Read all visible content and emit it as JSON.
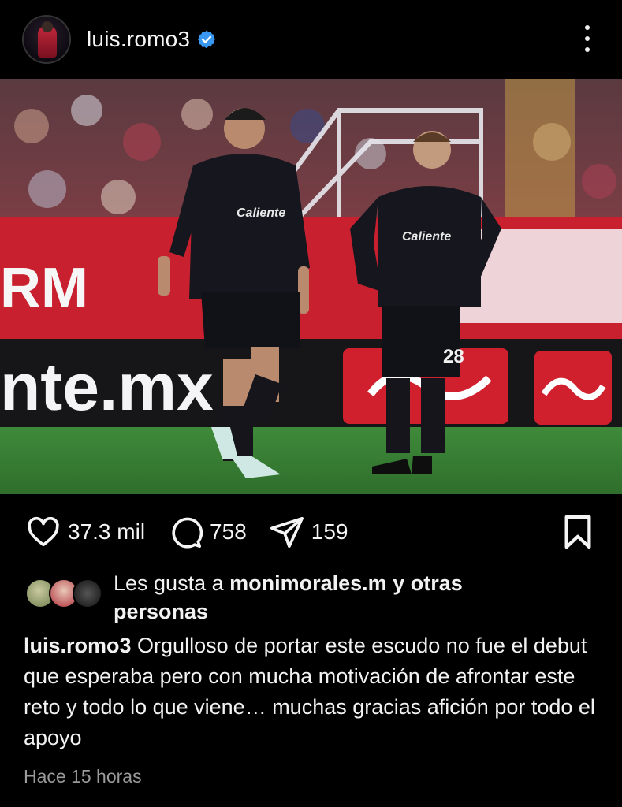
{
  "post": {
    "username": "luis.romo3",
    "verified": true,
    "icons": {
      "avatar": "profile-avatar",
      "verified": "verified-badge-icon",
      "more": "more-vertical-icon",
      "like": "heart-icon",
      "comment": "comment-icon",
      "share": "share-icon",
      "save": "bookmark-icon"
    },
    "colors": {
      "background": "#000000",
      "verified_badge": "#3897f0",
      "muted_text": "#9a9a9a"
    }
  },
  "photo": {
    "banner_top": "RM",
    "banner_bottom": "nte.mx",
    "jersey_sponsor": "Caliente",
    "jersey_sponsor_sub": "caliente.mx",
    "player_number": "28"
  },
  "actions": {
    "likes_count": "37.3 mil",
    "comments_count": "758",
    "shares_count": "159"
  },
  "liked_by": {
    "prefix": "Les gusta a",
    "user": "monimorales.m",
    "suffix": "y otras personas",
    "suffix_1": "y otras",
    "suffix_2": "personas"
  },
  "caption": {
    "user": "luis.romo3",
    "text": "Orgulloso de portar este escudo no fue el debut que esperaba pero con mucha motivación de afrontar este reto y todo lo que viene… muchas gracias afición por todo el apoyo"
  },
  "timestamp": "Hace 15 horas"
}
